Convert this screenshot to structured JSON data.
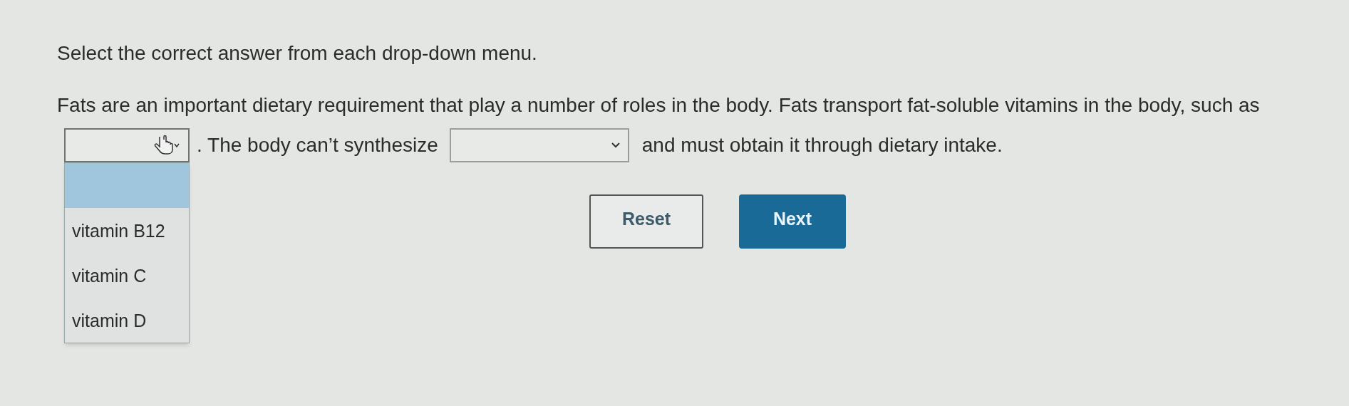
{
  "instruction": "Select the correct answer from each drop-down menu.",
  "question": {
    "line_1": "Fats are an important dietary requirement that play a number of roles in the body. Fats transport fat-soluble vitamins in the body, such as",
    "dropdown_1": {
      "expanded": true,
      "options": [
        {
          "selected": true
        },
        {
          "label": "vitamin B12",
          "selected": false
        },
        {
          "label": "vitamin C",
          "selected": false
        },
        {
          "label": "vitamin D",
          "selected": false
        }
      ]
    },
    "text_2": ". The body can’t synthesize",
    "dropdown_2": {
      "expanded": false
    },
    "text_3": "and must obtain it through dietary intake."
  },
  "buttons": [
    {
      "label": "Reset",
      "kind": "secondary"
    },
    {
      "label": "Next",
      "kind": "primary"
    }
  ]
}
